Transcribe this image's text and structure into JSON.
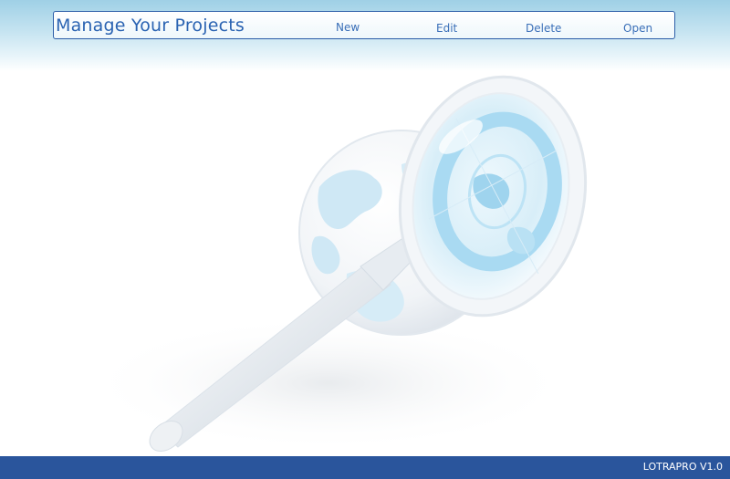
{
  "header": {
    "title": "Manage Your Projects",
    "menu": {
      "new_label": "New",
      "edit_label": "Edit",
      "delete_label": "Delete",
      "open_label": "Open"
    }
  },
  "illustration": {
    "icon": "magnifier-over-globe-icon"
  },
  "footer": {
    "version": "LOTRAPRO V1.0"
  },
  "colors": {
    "accent": "#2a63b2",
    "footer_bar": "#2a559c",
    "header_gradient": "#9fd0e6"
  }
}
